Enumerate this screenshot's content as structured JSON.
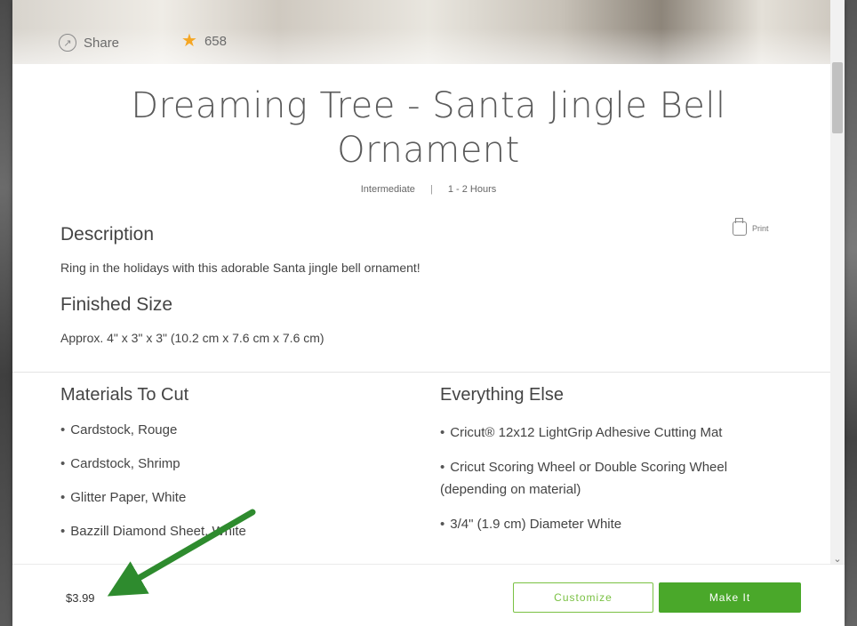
{
  "header": {
    "share_label": "Share",
    "favorites_count": "658"
  },
  "project": {
    "title_line1": "Dreaming Tree - Santa Jingle Bell",
    "title_line2": "Ornament",
    "difficulty": "Intermediate",
    "separator": "|",
    "duration": "1 - 2 Hours"
  },
  "description": {
    "heading": "Description",
    "text": "Ring in the holidays with this adorable Santa jingle bell ornament!",
    "print_label": "Print"
  },
  "finished_size": {
    "heading": "Finished Size",
    "text": "Approx. 4\" x 3\" x 3\" (10.2 cm x 7.6 cm x 7.6 cm)"
  },
  "materials": {
    "heading": "Materials To Cut",
    "items": [
      "Cardstock, Rouge",
      "Cardstock, Shrimp",
      "Glitter Paper, White",
      "Bazzill Diamond Sheet, White"
    ]
  },
  "everything_else": {
    "heading": "Everything Else",
    "items": [
      "Cricut® 12x12 LightGrip Adhesive Cutting Mat",
      "Cricut Scoring Wheel or Double Scoring Wheel (depending on material)",
      "3/4\" (1.9 cm) Diameter White"
    ]
  },
  "footer": {
    "price": "$3.99",
    "customize_label": "Customize",
    "make_label": "Make It"
  },
  "colors": {
    "accent_green": "#4aa82a",
    "outline_green": "#7ac143",
    "annotation_arrow": "#2e8b2e",
    "star": "#f5a623"
  }
}
